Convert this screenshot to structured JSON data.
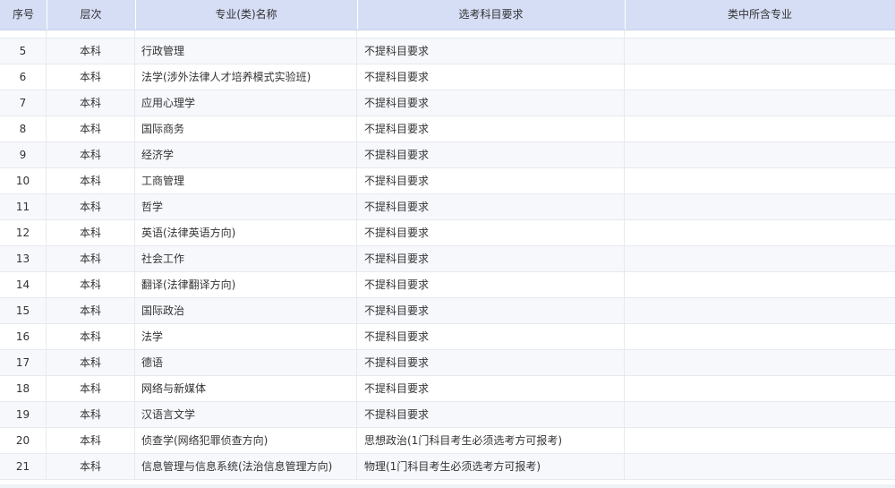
{
  "table": {
    "headers": {
      "no": "序号",
      "level": "层次",
      "name": "专业(类)名称",
      "requirement": "选考科目要求",
      "included": "类中所含专业"
    },
    "rows": [
      {
        "no": "",
        "level": "",
        "name": "",
        "requirement": "",
        "included": ""
      },
      {
        "no": "5",
        "level": "本科",
        "name": "行政管理",
        "requirement": "不提科目要求",
        "included": ""
      },
      {
        "no": "6",
        "level": "本科",
        "name": "法学(涉外法律人才培养模式实验班)",
        "requirement": "不提科目要求",
        "included": ""
      },
      {
        "no": "7",
        "level": "本科",
        "name": "应用心理学",
        "requirement": "不提科目要求",
        "included": ""
      },
      {
        "no": "8",
        "level": "本科",
        "name": "国际商务",
        "requirement": "不提科目要求",
        "included": ""
      },
      {
        "no": "9",
        "level": "本科",
        "name": "经济学",
        "requirement": "不提科目要求",
        "included": ""
      },
      {
        "no": "10",
        "level": "本科",
        "name": "工商管理",
        "requirement": "不提科目要求",
        "included": ""
      },
      {
        "no": "11",
        "level": "本科",
        "name": "哲学",
        "requirement": "不提科目要求",
        "included": ""
      },
      {
        "no": "12",
        "level": "本科",
        "name": "英语(法律英语方向)",
        "requirement": "不提科目要求",
        "included": ""
      },
      {
        "no": "13",
        "level": "本科",
        "name": "社会工作",
        "requirement": "不提科目要求",
        "included": ""
      },
      {
        "no": "14",
        "level": "本科",
        "name": "翻译(法律翻译方向)",
        "requirement": "不提科目要求",
        "included": ""
      },
      {
        "no": "15",
        "level": "本科",
        "name": "国际政治",
        "requirement": "不提科目要求",
        "included": ""
      },
      {
        "no": "16",
        "level": "本科",
        "name": "法学",
        "requirement": "不提科目要求",
        "included": ""
      },
      {
        "no": "17",
        "level": "本科",
        "name": "德语",
        "requirement": "不提科目要求",
        "included": ""
      },
      {
        "no": "18",
        "level": "本科",
        "name": "网络与新媒体",
        "requirement": "不提科目要求",
        "included": ""
      },
      {
        "no": "19",
        "level": "本科",
        "name": "汉语言文学",
        "requirement": "不提科目要求",
        "included": ""
      },
      {
        "no": "20",
        "level": "本科",
        "name": "侦查学(网络犯罪侦查方向)",
        "requirement": "思想政治(1门科目考生必须选考方可报考)",
        "included": ""
      },
      {
        "no": "21",
        "level": "本科",
        "name": "信息管理与信息系统(法治信息管理方向)",
        "requirement": "物理(1门科目考生必须选考方可报考)",
        "included": ""
      }
    ]
  }
}
